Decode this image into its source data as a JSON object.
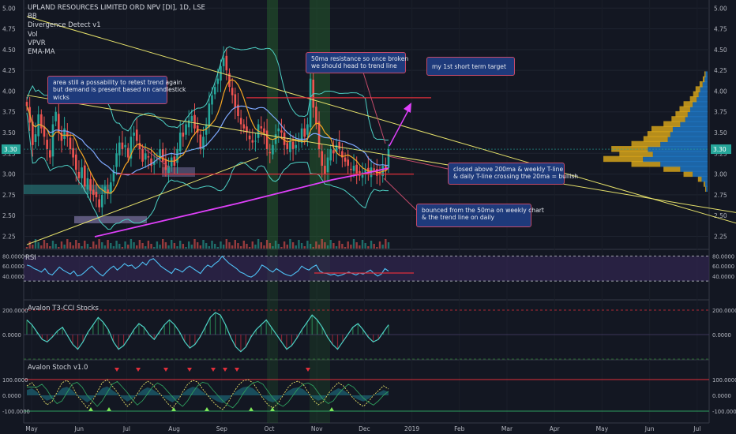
{
  "header": {
    "symbol_title": "UPLAND RESOURCES LIMITED ORD NPV [DI], 1D, LSE",
    "indicators": [
      "BB",
      "Divergence Detect v1",
      "Vol",
      "VPVR",
      "EMA-MA"
    ]
  },
  "colors": {
    "background": "#131722",
    "candle_up": "#26a69a",
    "candle_down": "#ef5350",
    "trendline": "#e5e06a",
    "support_resistance": "#e02f3b",
    "ma200": "#e040fb",
    "ma50": "#7fa9ff",
    "ema": "#f5a623",
    "bollinger": "#4dd0c4",
    "rsi": "#4fc3f7",
    "annotation_box": "#1e3a7b",
    "annotation_border": "#c44a6a",
    "vpvr_up": "#1e73be",
    "vpvr_down": "#d4a21a"
  },
  "annotations": [
    {
      "id": "retest",
      "lines": [
        "area still a possability to retest trend again",
        "but demand is present based on candlestick",
        "wicks"
      ]
    },
    {
      "id": "resistance",
      "lines": [
        "50ma resistance so once broken",
        "we should head to trend line"
      ]
    },
    {
      "id": "target",
      "lines": [
        "my 1st short term target"
      ]
    },
    {
      "id": "closed",
      "lines": [
        "closed above 200ma & weekly T-line",
        "& daily T-line crossing the 20ma = bullish"
      ]
    },
    {
      "id": "bounced",
      "lines": [
        "bounced from the 50ma on weekly chart",
        "& the trend line on daily"
      ]
    }
  ],
  "price_badge": "3.30",
  "panes": {
    "rsi": {
      "label": "RSI",
      "ticks": [
        "80.0000",
        "60.0000",
        "40.0000"
      ]
    },
    "cci": {
      "label": "Avalon T3-CCI Stocks",
      "ticks": [
        "200.0000",
        "0.0000"
      ]
    },
    "stoch": {
      "label": "Avalon Stoch v1.0",
      "ticks": [
        "100.0000",
        "0.0000",
        "-100.0000"
      ]
    }
  },
  "chart_data": {
    "type": "candlestick",
    "y_axis": {
      "ticks": [
        "5.00",
        "4.75",
        "4.50",
        "4.25",
        "4.00",
        "3.75",
        "3.50",
        "3.25",
        "3.00",
        "2.75",
        "2.50",
        "2.25"
      ],
      "ylim": [
        2.15,
        5.05
      ]
    },
    "x_axis": {
      "tick_labels": [
        "May",
        "Jun",
        "Jul",
        "Aug",
        "Sep",
        "Oct",
        "Nov",
        "Dec",
        "2019",
        "Feb",
        "Mar",
        "Apr",
        "May",
        "Jun",
        "Jul"
      ]
    },
    "close": [
      3.82,
      3.62,
      3.35,
      3.48,
      3.72,
      3.55,
      3.45,
      3.3,
      3.2,
      3.6,
      3.75,
      3.5,
      3.4,
      3.55,
      3.45,
      3.3,
      3.2,
      3.05,
      2.95,
      3.08,
      2.85,
      2.95,
      2.8,
      2.75,
      2.72,
      2.6,
      2.75,
      2.85,
      2.78,
      2.9,
      3.05,
      3.25,
      3.38,
      3.3,
      3.35,
      3.2,
      3.45,
      3.5,
      3.4,
      3.3,
      3.15,
      3.25,
      3.2,
      3.1,
      3.15,
      3.2,
      3.3,
      3.15,
      3.05,
      3.1,
      3.2,
      3.1,
      3.3,
      3.5,
      3.45,
      3.6,
      3.65,
      3.7,
      3.55,
      3.5,
      3.3,
      3.45,
      3.6,
      3.85,
      3.95,
      4.05,
      4.15,
      4.3,
      4.4,
      4.25,
      4.05,
      3.95,
      3.8,
      3.7,
      3.6,
      3.55,
      3.5,
      3.42,
      3.38,
      3.4,
      3.6,
      3.55,
      3.5,
      3.3,
      3.25,
      3.35,
      3.48,
      3.55,
      3.5,
      3.35,
      3.3,
      3.4,
      3.3,
      3.35,
      3.4,
      3.55,
      3.45,
      3.6,
      4.15,
      3.8,
      3.6,
      3.3,
      3.1,
      3.0,
      3.2,
      3.3,
      3.25,
      3.35,
      3.3,
      3.2,
      3.15,
      3.1,
      3.05,
      3.1,
      3.0,
      2.98,
      3.02,
      3.05,
      3.0,
      3.08,
      3.05,
      2.98,
      3.0,
      3.1,
      3.05,
      3.3
    ],
    "volume_scale_note": "",
    "trendlines": [
      {
        "name": "",
        "from": [
          0,
          4.9
        ],
        "to": [
          305,
          1.8
        ]
      },
      {
        "name": "",
        "from": [
          0,
          3.95
        ],
        "to": [
          260,
          2.45
        ]
      },
      {
        "name": "",
        "from": [
          0,
          2.15
        ],
        "to": [
          80,
          3.2
        ]
      }
    ],
    "horizontal_levels": [
      3.0,
      3.92
    ],
    "vpvr_levels": [
      2.82,
      2.88,
      2.94,
      3.0,
      3.06,
      3.12,
      3.18,
      3.24,
      3.3,
      3.36,
      3.42,
      3.48,
      3.54,
      3.6,
      3.66,
      3.72,
      3.78,
      3.84,
      3.9,
      3.96,
      4.02,
      4.08,
      4.14,
      4.2
    ],
    "vpvr_volumes": [
      3,
      5,
      12,
      30,
      55,
      95,
      130,
      110,
      120,
      95,
      80,
      75,
      70,
      55,
      45,
      40,
      35,
      30,
      22,
      18,
      15,
      10,
      6,
      4
    ],
    "rsi": [
      62,
      60,
      55,
      52,
      48,
      55,
      45,
      42,
      50,
      58,
      52,
      48,
      44,
      50,
      40,
      42,
      48,
      55,
      60,
      52,
      45,
      40,
      48,
      55,
      60,
      52,
      58,
      65,
      60,
      62,
      55,
      60,
      68,
      62,
      72,
      75,
      68,
      60,
      55,
      50,
      45,
      55,
      52,
      48,
      55,
      60,
      55,
      50,
      45,
      55,
      62,
      58,
      65,
      70,
      80,
      72,
      65,
      60,
      55,
      48,
      45,
      40,
      38,
      42,
      50,
      62,
      58,
      52,
      48,
      55,
      50,
      45,
      42,
      40,
      45,
      50,
      60,
      55,
      52,
      58,
      62,
      50,
      46,
      45,
      42,
      44,
      40,
      42,
      45,
      48,
      45,
      42,
      46,
      44,
      48,
      52,
      45,
      40,
      44,
      55,
      50
    ],
    "cci": [
      120,
      80,
      20,
      -40,
      -60,
      -20,
      30,
      60,
      -10,
      -80,
      -120,
      -60,
      20,
      80,
      140,
      100,
      40,
      -60,
      -120,
      -90,
      -30,
      40,
      90,
      60,
      0,
      -40,
      20,
      80,
      120,
      80,
      20,
      -60,
      -110,
      -80,
      -20,
      60,
      140,
      180,
      160,
      80,
      -20,
      -100,
      -140,
      -100,
      -20,
      40,
      80,
      120,
      60,
      0,
      -60,
      -120,
      -90,
      -30,
      40,
      100,
      160,
      120,
      60,
      -20,
      -80,
      -120,
      -60,
      0,
      60,
      90,
      40,
      -20,
      -60,
      -40,
      20,
      80
    ],
    "stoch": [
      60,
      80,
      40,
      -20,
      -60,
      -40,
      20,
      80,
      95,
      60,
      0,
      -40,
      -80,
      -40,
      20,
      80,
      100,
      60,
      20,
      -30,
      -70,
      -40,
      10,
      60,
      90,
      70,
      30,
      -10,
      -50,
      -80,
      -40,
      20,
      70,
      95,
      85,
      40,
      0,
      -40,
      -70,
      -90,
      -50,
      10,
      60,
      90,
      100,
      80,
      30,
      -20,
      -60,
      -80,
      -50,
      0,
      50,
      80,
      90,
      70,
      20,
      -30,
      -60,
      -40,
      10,
      50,
      80,
      60,
      20,
      -20,
      -50,
      -70,
      -40,
      0,
      30,
      60,
      40
    ]
  }
}
